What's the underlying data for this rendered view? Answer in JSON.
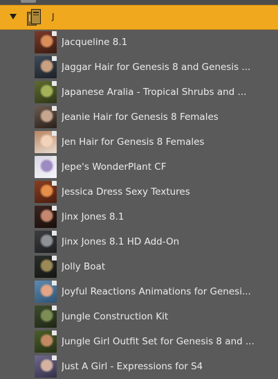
{
  "folder": {
    "label": "J",
    "expanded": true,
    "highlight_color": "#f0a81e"
  },
  "items": [
    {
      "label": "Jacqueline 8.1",
      "thumb": [
        "#7a3a2a",
        "#d98e5a",
        "#3b1b12"
      ]
    },
    {
      "label": "Jaggar Hair for Genesis 8 and Genesis ...",
      "thumb": [
        "#3d4a58",
        "#c9a081",
        "#1d2228"
      ]
    },
    {
      "label": "Japanese Aralia - Tropical Shrubs and ...",
      "thumb": [
        "#5e6b2e",
        "#a4b35a",
        "#2e3818"
      ]
    },
    {
      "label": "Jeanie Hair for Genesis 8 Females",
      "thumb": [
        "#6b5a4e",
        "#c7a690",
        "#2a201b"
      ]
    },
    {
      "label": "Jen Hair for Genesis 8 Females",
      "thumb": [
        "#b88462",
        "#f2d2b8",
        "#e8dcd0"
      ]
    },
    {
      "label": "Jepe's WonderPlant CF",
      "thumb": [
        "#d9d6e4",
        "#9c8ac2",
        "#f4f3f8"
      ]
    },
    {
      "label": "Jessica Dress Sexy Textures",
      "thumb": [
        "#8a3e20",
        "#e58f4a",
        "#4a1e10"
      ]
    },
    {
      "label": "Jinx Jones 8.1",
      "thumb": [
        "#3a2420",
        "#c48770",
        "#1a0f0c"
      ]
    },
    {
      "label": "Jinx Jones 8.1 HD Add-On",
      "thumb": [
        "#3b3d40",
        "#8e9195",
        "#1e1f21"
      ]
    },
    {
      "label": "Jolly Boat",
      "thumb": [
        "#2a2e2a",
        "#9c8a56",
        "#141714"
      ]
    },
    {
      "label": "Joyful Reactions Animations for Genesi...",
      "thumb": [
        "#5d8bb0",
        "#e3a585",
        "#2f5474"
      ]
    },
    {
      "label": "Jungle Construction Kit",
      "thumb": [
        "#3e4c2c",
        "#7c8e55",
        "#1f2716"
      ]
    },
    {
      "label": "Jungle Girl Outfit Set for Genesis 8 and ...",
      "thumb": [
        "#4c5e2a",
        "#c28a62",
        "#263014"
      ]
    },
    {
      "label": "Just A Girl - Expressions for S4",
      "thumb": [
        "#6f6a8e",
        "#d6b3a1",
        "#34304a"
      ]
    }
  ]
}
